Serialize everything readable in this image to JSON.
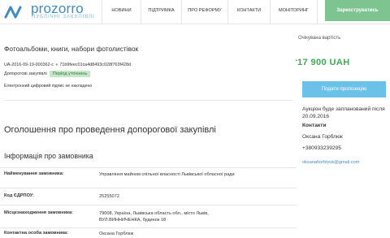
{
  "header": {
    "logo_name": "prozorro",
    "logo_tagline": "ПУБЛІЧНІ ЗАКУПІВЛІ",
    "nav": [
      "НОВИНИ",
      "ПІДТРИМКА",
      "ПРО РЕФОРМУ",
      "КОНТАКТИ",
      "МОНІТОРИНГ"
    ],
    "register_label": "Зареєструватись"
  },
  "tender": {
    "title": "Фотоальбоми, книги, набори фотолистівок",
    "id": "UA-2016-09-19-000362-c",
    "hash": "71b9feec01ca4d8493c028f763f428d",
    "type": "Допорогові закупівлі",
    "status": "Період уточнень",
    "signature_note": "Електронний цифровий підпис не накладено"
  },
  "sidebar": {
    "expected_label": "Очікувана вартість",
    "price": "17 900 UAH",
    "proposal_button": "Подати пропозицію",
    "auction_note": "Аукціон буде запланований після 20.09.2016",
    "contacts_title": "Контакти",
    "contact_name": "Оксана Горблюк",
    "contact_phone": "+380933239295",
    "contact_email": "oksanahorblyuk@gmail.com"
  },
  "main": {
    "section_title": "Оголошення про проведення допорогової закупівлі",
    "subsection_title": "Інформація про замовника",
    "rows": [
      {
        "key": "Найменування замовника:",
        "value": "Управління майном спільної власності Львівської обласної ради"
      },
      {
        "key": "Код ЄДРПОУ:",
        "value": "25255072"
      },
      {
        "key": "Місцезнаходження замовника:",
        "value": "79008, Україна, Львівська область обл., місто Львів, ВУЛ.ВИННИЧЕНКА, будинок 18"
      },
      {
        "key": "Контактна особа замовника:",
        "value": "Оксана Горблюк"
      }
    ]
  },
  "colors": {
    "brand_blue": "#3f8dbe",
    "register_green": "#7ec491",
    "price_green": "#3eaa55",
    "button_blue": "#6cc1e8",
    "status_bg": "#c6e7c9"
  }
}
